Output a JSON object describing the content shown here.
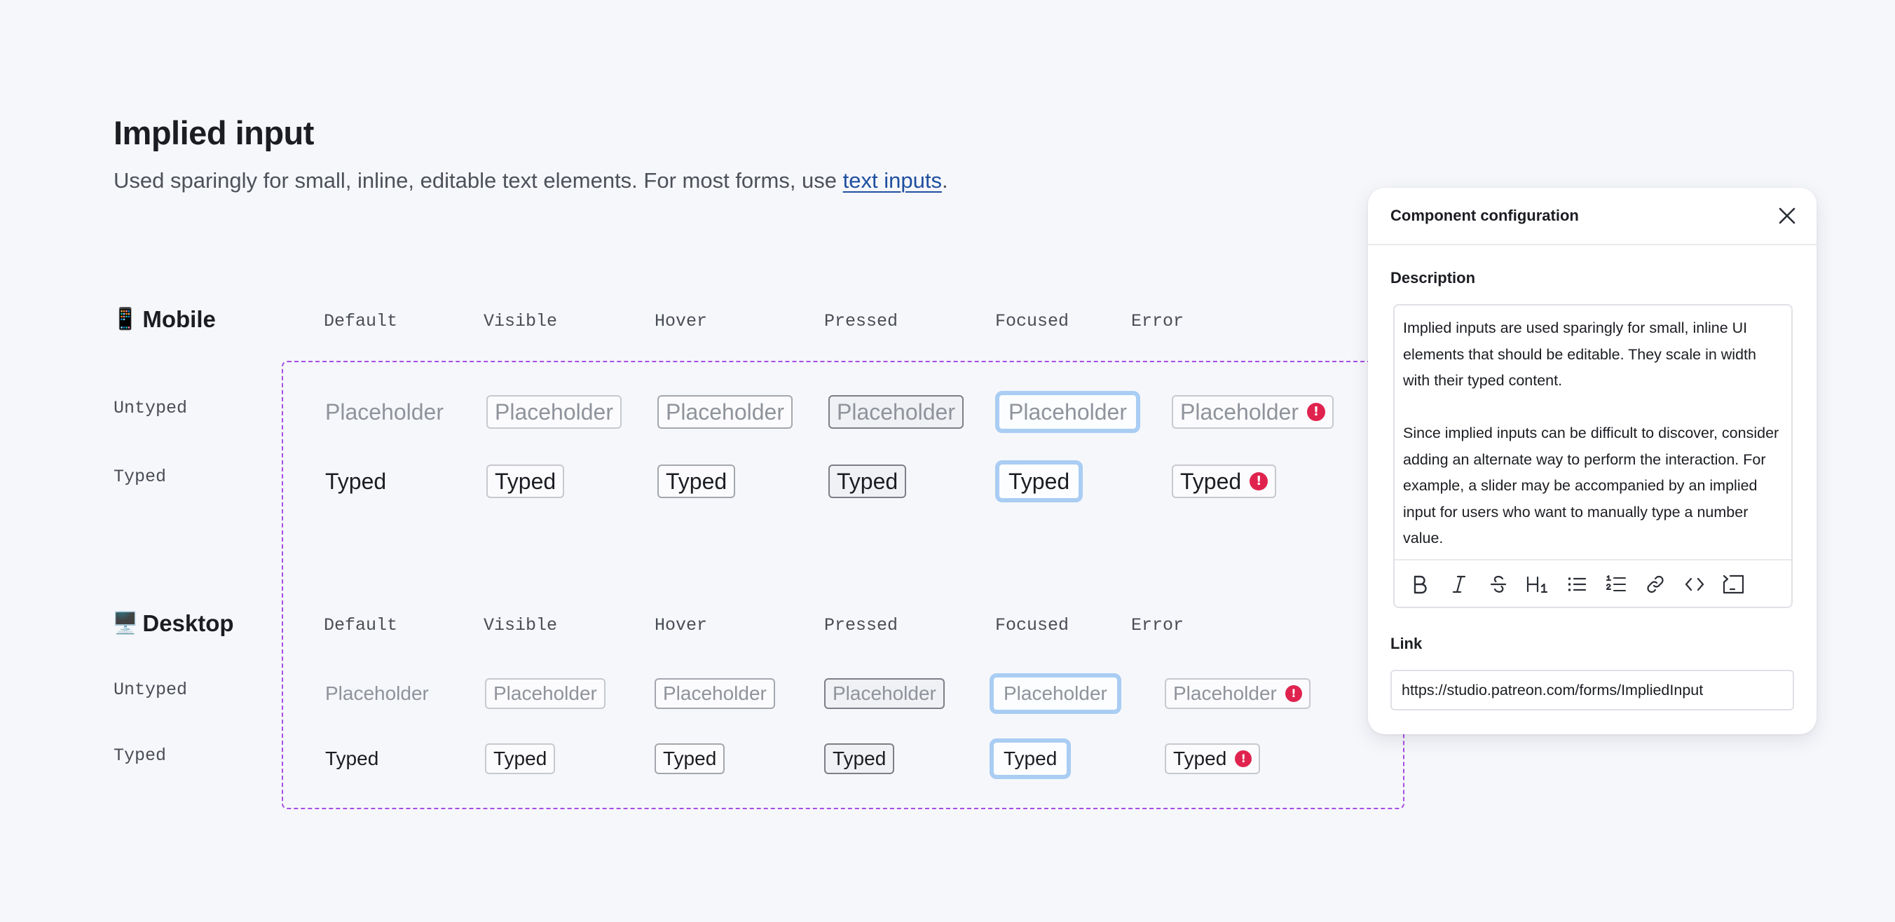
{
  "header": {
    "title": "Implied input",
    "subtitle_prefix": "Used sparingly for small, inline, editable text elements. For most forms, use ",
    "subtitle_link": "text inputs",
    "subtitle_suffix": "."
  },
  "states": [
    "Default",
    "Visible",
    "Hover",
    "Pressed",
    "Focused",
    "Error"
  ],
  "mobile": {
    "icon": "📱",
    "title": "Mobile",
    "rows": {
      "untyped": {
        "label": "Untyped",
        "value": "Placeholder"
      },
      "typed": {
        "label": "Typed",
        "value": "Typed"
      }
    }
  },
  "desktop": {
    "icon": "🖥️",
    "title": "Desktop",
    "rows": {
      "untyped": {
        "label": "Untyped",
        "value": "Placeholder"
      },
      "typed": {
        "label": "Typed",
        "value": "Typed"
      }
    }
  },
  "error_mark": "!",
  "panel": {
    "title": "Component configuration",
    "description_label": "Description",
    "description_p1": "Implied inputs are used sparingly for small, inline UI elements that should be editable. They scale in width with their typed content.",
    "description_p2": "Since implied inputs can be difficult to discover, consider adding an alternate way to perform the interaction. For example, a slider may be accompanied by an implied input for users who want to manually type a number value.",
    "toolbar": [
      "bold-icon",
      "italic-icon",
      "strikethrough-icon",
      "heading-icon",
      "bullet-list-icon",
      "numbered-list-icon",
      "link-icon",
      "code-icon",
      "code-block-icon"
    ],
    "link_label": "Link",
    "link_value": "https://studio.patreon.com/forms/ImpliedInput"
  },
  "colors": {
    "accent_dashed": "#a54ee4",
    "focus_ring": "#a9cdf3",
    "error": "#e0234e",
    "link": "#1f4fa0"
  }
}
